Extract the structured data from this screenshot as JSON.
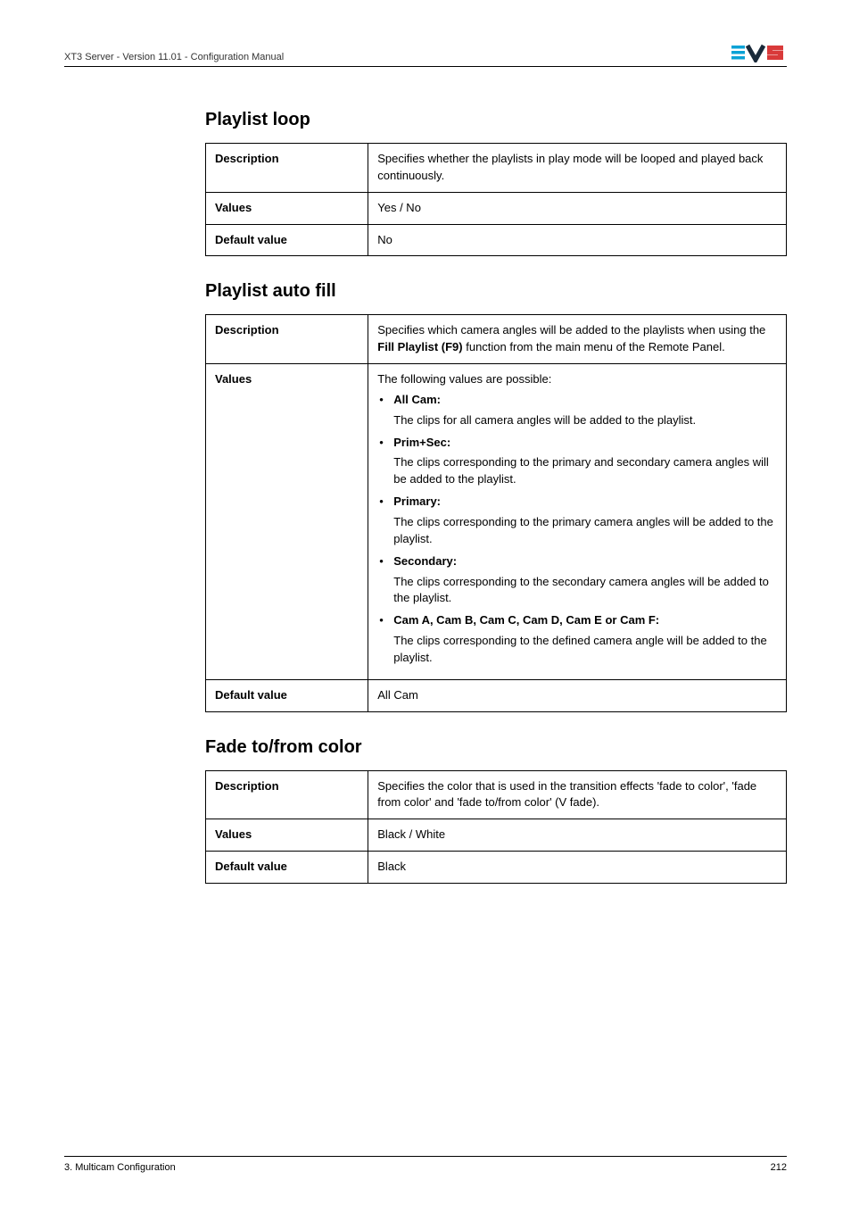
{
  "header": {
    "doc_title": "XT3 Server - Version 11.01 - Configuration Manual",
    "logo_parts": {
      "l1": "≡",
      "l2": "V",
      "l3": "5"
    }
  },
  "sections": [
    {
      "heading": "Playlist loop",
      "rows": {
        "description_label": "Description",
        "description_value": "Specifies whether the playlists in play mode will be looped and played back continuously.",
        "values_label": "Values",
        "values_value": "Yes / No",
        "default_label": "Default value",
        "default_value": "No"
      }
    },
    {
      "heading": "Playlist auto fill",
      "rows": {
        "description_label": "Description",
        "description_pre": "Specifies which camera angles will be added to the playlists when using the ",
        "description_bold": "Fill Playlist (F9)",
        "description_post": " function from the main menu of the Remote Panel.",
        "values_label": "Values",
        "values_intro": "The following values are possible:",
        "values_items": [
          {
            "term": "All Cam:",
            "detail": "The clips for all camera angles will be added to the playlist."
          },
          {
            "term": "Prim+Sec:",
            "detail": "The clips corresponding to the primary and secondary camera angles will be added to the playlist."
          },
          {
            "term": "Primary:",
            "detail": "The clips corresponding to the primary camera angles will be added to the playlist."
          },
          {
            "term": "Secondary:",
            "detail": "The clips corresponding to the secondary camera angles will be added to the playlist."
          },
          {
            "term": "Cam A, Cam B, Cam C, Cam D, Cam E or Cam F:",
            "detail": "The clips corresponding to the defined camera angle will be added to the playlist."
          }
        ],
        "default_label": "Default value",
        "default_value": "All Cam"
      }
    },
    {
      "heading": "Fade to/from color",
      "rows": {
        "description_label": "Description",
        "description_value": "Specifies the color that is used in the transition effects 'fade to color', 'fade from color' and 'fade to/from color' (V fade).",
        "values_label": "Values",
        "values_value": "Black / White",
        "default_label": "Default value",
        "default_value": "Black"
      }
    }
  ],
  "footer": {
    "left": "3. Multicam Configuration",
    "right": "212"
  }
}
